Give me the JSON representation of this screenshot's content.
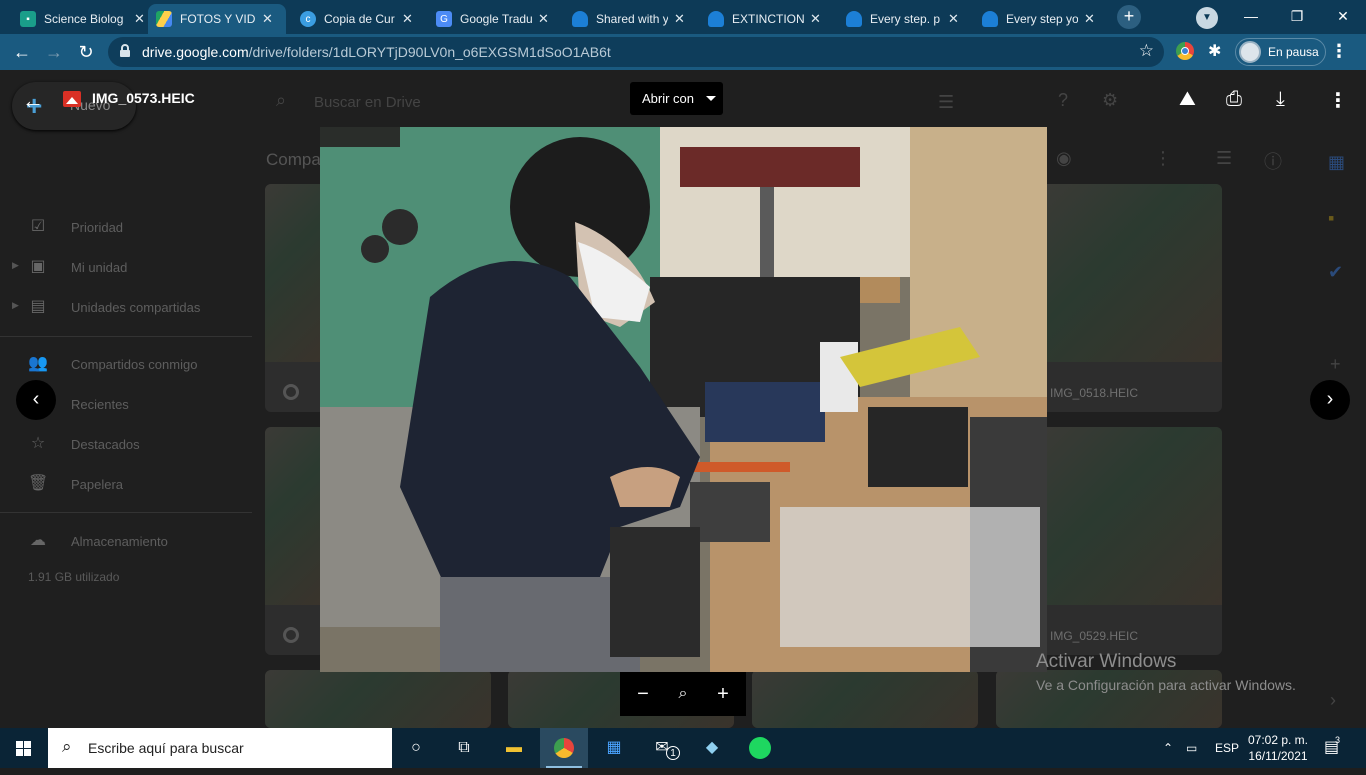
{
  "browser": {
    "tabs": [
      {
        "title": "Science Biolog",
        "icon": "classroom-icon",
        "color": "#1a9e8a",
        "active": false
      },
      {
        "title": "FOTOS Y VIDE",
        "icon": "google-drive-icon",
        "color": "#f4b400",
        "active": true
      },
      {
        "title": "Copia de Cur",
        "icon": "canva-icon",
        "color": "#3b9de1",
        "active": false
      },
      {
        "title": "Google Tradu",
        "icon": "google-translate-icon",
        "color": "#4c8bf5",
        "active": false
      },
      {
        "title": "Shared with y",
        "icon": "onedrive-icon",
        "color": "#1c7fd6",
        "active": false
      },
      {
        "title": "EXTINCTION",
        "icon": "onedrive-icon",
        "color": "#1c7fd6",
        "active": false
      },
      {
        "title": "Every step. p",
        "icon": "onedrive-icon",
        "color": "#1c7fd6",
        "active": false
      },
      {
        "title": "Every step yo",
        "icon": "onedrive-icon",
        "color": "#1c7fd6",
        "active": false
      }
    ],
    "url_host": "drive.google.com",
    "url_path": "/drive/folders/1dLORYTjD90LV0n_o6EXGSM1dSoO1AB6t",
    "profile_label": "En pausa"
  },
  "drive": {
    "new_label": "Nuevo",
    "nav": [
      {
        "label": "Prioridad",
        "icon": "checkbox-icon"
      },
      {
        "label": "Mi unidad",
        "icon": "my-drive-icon"
      },
      {
        "label": "Unidades compartidas",
        "icon": "shared-drives-icon"
      },
      {
        "label": "Compartidos conmigo",
        "icon": "people-icon"
      },
      {
        "label": "Recientes",
        "icon": "clock-icon"
      },
      {
        "label": "Destacados",
        "icon": "star-icon"
      },
      {
        "label": "Papelera",
        "icon": "trash-icon"
      },
      {
        "label": "Almacenamiento",
        "icon": "cloud-icon"
      }
    ],
    "storage_used": "1.91 GB utilizado",
    "search_placeholder": "Buscar en Drive",
    "breadcrumb": "Compa",
    "files": [
      "IMG_0518.HEIC",
      "IMG_0529.HEIC"
    ]
  },
  "viewer": {
    "filename": "IMG_0573.HEIC",
    "open_with": "Abrir con"
  },
  "watermark": {
    "line1": "Activar Windows",
    "line2": "Ve a Configuración para activar Windows."
  },
  "taskbar": {
    "search_placeholder": "Escribe aquí para buscar",
    "language": "ESP",
    "time": "07:02 p. m.",
    "date": "16/11/2021",
    "mail_badge": "1",
    "notification_count": "3"
  }
}
